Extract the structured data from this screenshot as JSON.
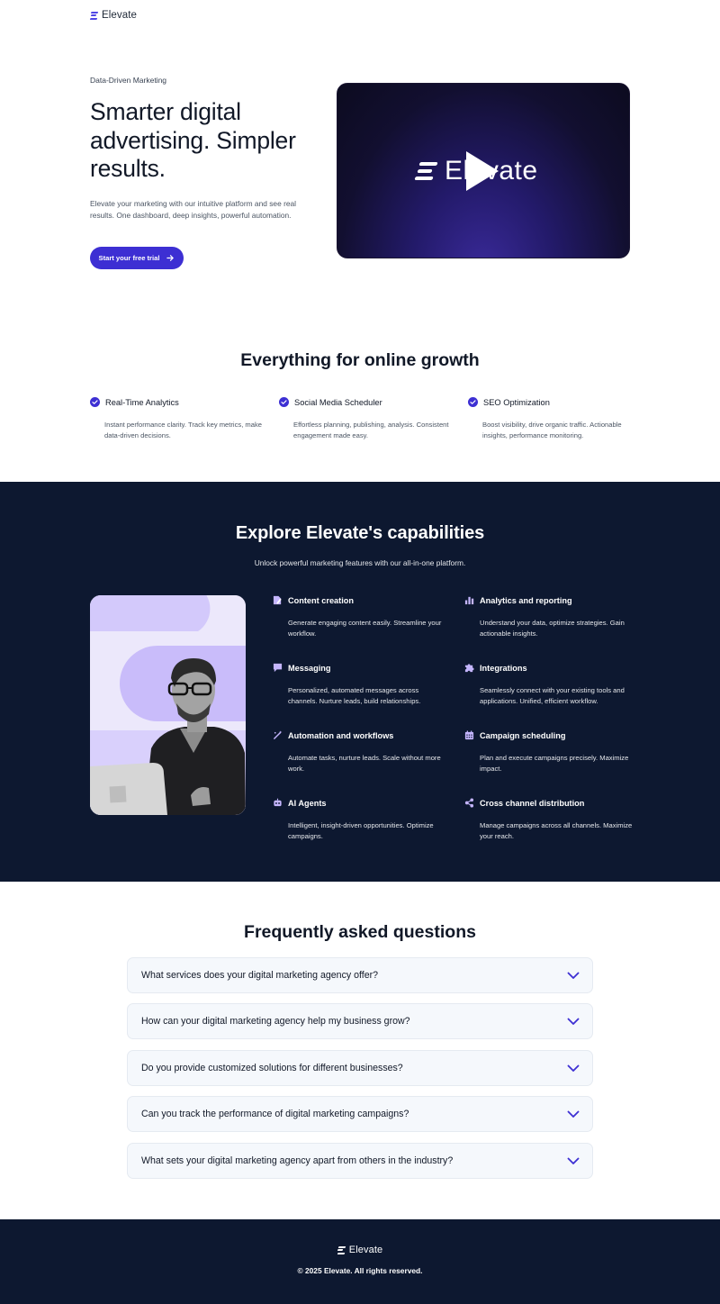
{
  "header": {
    "brand": "Elevate"
  },
  "hero": {
    "eyebrow": "Data-Driven Marketing",
    "title": "Smarter digital advertising. Simpler results.",
    "description": "Elevate your marketing with our intuitive platform and see real results. One dashboard, deep insights, powerful automation.",
    "cta_label": "Start your free trial",
    "video_brand": "Elevate"
  },
  "features": {
    "title": "Everything for online growth",
    "items": [
      {
        "title": "Real-Time Analytics",
        "desc": "Instant performance clarity. Track key metrics, make data-driven decisions."
      },
      {
        "title": "Social Media Scheduler",
        "desc": "Effortless planning, publishing, analysis. Consistent engagement made easy."
      },
      {
        "title": "SEO Optimization",
        "desc": "Boost visibility, drive organic traffic. Actionable insights, performance monitoring."
      }
    ]
  },
  "capabilities": {
    "title": "Explore Elevate's capabilities",
    "subtitle": "Unlock powerful marketing features with our all-in-one platform.",
    "items": [
      {
        "icon": "pen-icon",
        "title": "Content creation",
        "desc": "Generate engaging content easily. Streamline your workflow."
      },
      {
        "icon": "bar-chart-icon",
        "title": "Analytics and reporting",
        "desc": "Understand your data, optimize strategies. Gain actionable insights."
      },
      {
        "icon": "chat-icon",
        "title": "Messaging",
        "desc": "Personalized, automated messages across channels. Nurture leads, build relationships."
      },
      {
        "icon": "puzzle-icon",
        "title": "Integrations",
        "desc": "Seamlessly connect with your existing tools and applications. Unified, efficient workflow."
      },
      {
        "icon": "magic-wand-icon",
        "title": "Automation and workflows",
        "desc": "Automate tasks, nurture leads. Scale without more work."
      },
      {
        "icon": "calendar-icon",
        "title": "Campaign scheduling",
        "desc": "Plan and execute campaigns precisely. Maximize impact."
      },
      {
        "icon": "robot-icon",
        "title": "AI Agents",
        "desc": "Intelligent, insight-driven opportunities. Optimize campaigns."
      },
      {
        "icon": "share-icon",
        "title": "Cross channel distribution",
        "desc": "Manage campaigns across all channels. Maximize your reach."
      }
    ]
  },
  "faq": {
    "title": "Frequently asked questions",
    "items": [
      "What services does your digital marketing agency offer?",
      "How can your digital marketing agency help my business grow?",
      "Do you provide customized solutions for different businesses?",
      "Can you track the performance of digital marketing campaigns?",
      "What sets your digital marketing agency apart from others in the industry?"
    ]
  },
  "footer": {
    "brand": "Elevate",
    "copyright": "© 2025 Elevate. All rights reserved."
  },
  "colors": {
    "accent": "#3d2fd3",
    "dark_bg": "#0d1830",
    "faq_bg": "#f5f8fc"
  }
}
